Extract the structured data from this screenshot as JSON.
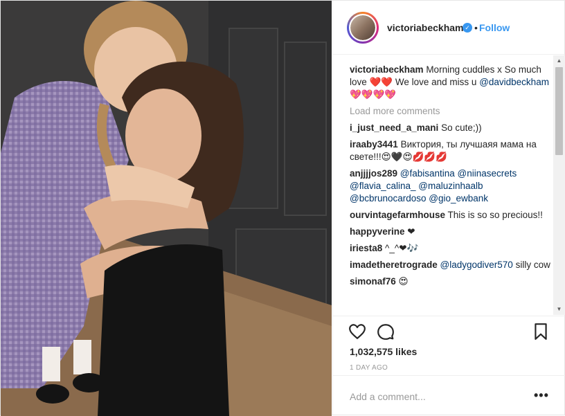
{
  "header": {
    "username": "victoriabeckham",
    "follow_label": "Follow",
    "separator": "•"
  },
  "caption": {
    "user": "victoriabeckham",
    "text_part1": " Morning cuddles x So much love ❤️❤️ We love and miss u ",
    "mention": "@davidbeckham",
    "text_part2": " 💖💖💖💖"
  },
  "load_more_label": "Load more comments",
  "comments": [
    {
      "user": "i_just_need_a_mani",
      "text": " So cute;))"
    },
    {
      "user": "iraaby3441",
      "text": " Виктория, ты лучшаяя мама на свете!!!😍🖤😍💋💋💋"
    },
    {
      "user": "anjjjjos289",
      "mentions": " @fabisantina @niinasecrets @flavia_calina_ @maluzinhaalb @bcbrunocardoso @gio_ewbank"
    },
    {
      "user": "ourvintagefarmhouse",
      "text": " This is so so precious!!"
    },
    {
      "user": "happyverine",
      "text": " ❤"
    },
    {
      "user": "iriesta8",
      "text": " ^_^❤🎶"
    },
    {
      "user": "imadetheretrograde",
      "mention": " @ladygodiver570",
      "text": " silly cow"
    },
    {
      "user": "simonaf76",
      "text": " 😍"
    }
  ],
  "actions": {
    "likes": "1,032,575 likes",
    "time": "1 DAY AGO"
  },
  "add_comment": {
    "placeholder": "Add a comment...",
    "more": "•••"
  },
  "icons": {
    "like": "heart-icon",
    "comment": "comment-icon",
    "save": "bookmark-icon",
    "verified": "verified-badge-icon",
    "scroll_up": "scroll-up-arrow-icon",
    "scroll_down": "scroll-down-arrow-icon"
  }
}
